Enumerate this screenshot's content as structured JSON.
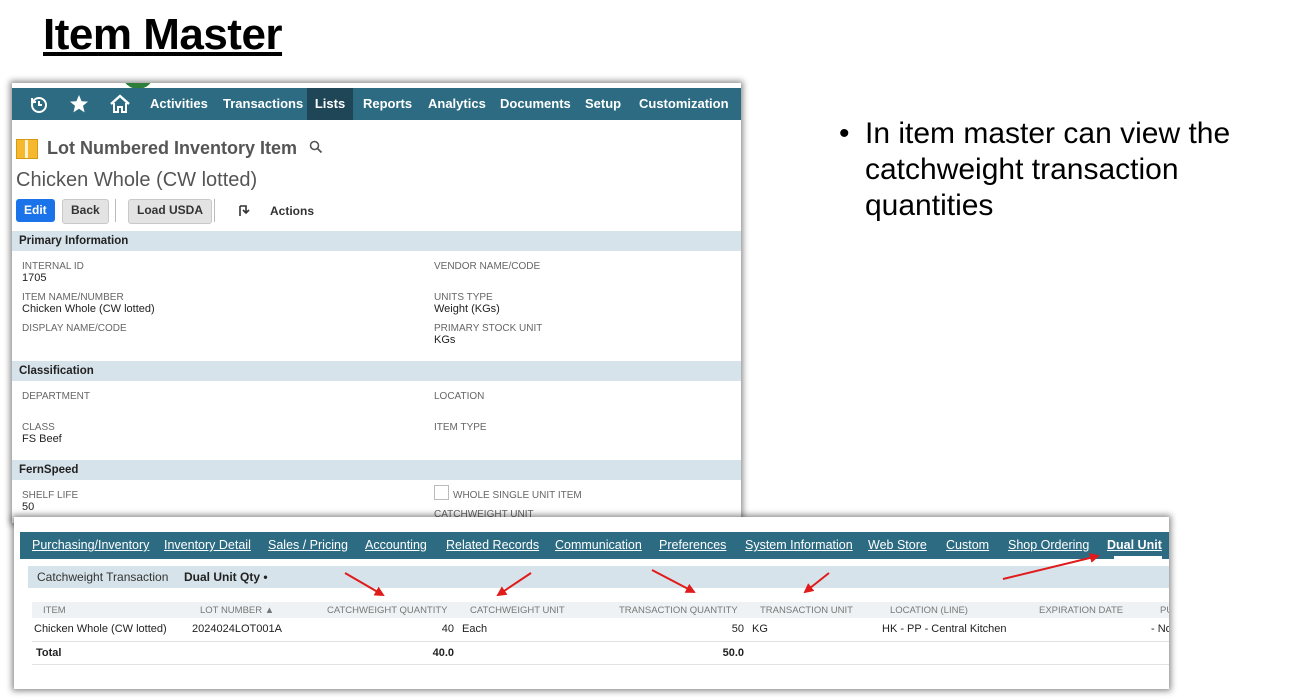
{
  "slide": {
    "title": "Item Master",
    "bullet": "In item master can view the catchweight transaction quantities"
  },
  "nav": {
    "icons": [
      "recent-icon",
      "star-icon",
      "home-icon"
    ],
    "items": [
      "Activities",
      "Transactions",
      "Lists",
      "Reports",
      "Analytics",
      "Documents",
      "Setup",
      "Customization"
    ],
    "active": "Lists"
  },
  "record": {
    "type": "Lot Numbered Inventory Item",
    "name": "Chicken Whole (CW lotted)",
    "buttons": {
      "edit": "Edit",
      "back": "Back",
      "load_usda": "Load USDA",
      "actions": "Actions"
    }
  },
  "primary_info": {
    "header": "Primary Information",
    "internal_id_label": "INTERNAL ID",
    "internal_id": "1705",
    "item_name_label": "ITEM NAME/NUMBER",
    "item_name": "Chicken Whole (CW lotted)",
    "display_name_label": "DISPLAY NAME/CODE",
    "vendor_name_label": "VENDOR NAME/CODE",
    "units_type_label": "UNITS TYPE",
    "units_type": "Weight (KGs)",
    "primary_stock_unit_label": "PRIMARY STOCK UNIT",
    "primary_stock_unit": "KGs"
  },
  "classification": {
    "header": "Classification",
    "department_label": "DEPARTMENT",
    "location_label": "LOCATION",
    "class_label": "CLASS",
    "class_value": "FS Beef",
    "item_type_label": "ITEM TYPE"
  },
  "fernspeed": {
    "header": "FernSpeed",
    "shelf_life_label": "SHELF LIFE",
    "shelf_life": "50",
    "whole_single_unit_label": "WHOLE SINGLE UNIT ITEM",
    "catchweight_unit_label": "CATCHWEIGHT UNIT"
  },
  "subtabs": {
    "tabs": [
      "Purchasing/Inventory",
      "Inventory Detail",
      "Sales / Pricing",
      "Accounting",
      "Related Records",
      "Communication",
      "Preferences",
      "System Information",
      "Web Store",
      "Custom",
      "Shop Ordering",
      "Dual Unit"
    ],
    "active": "Dual Unit",
    "inner_tabs": [
      "Catchweight Transaction",
      "Dual Unit Qty •"
    ],
    "inner_active": "Dual Unit Qty •"
  },
  "table": {
    "headers": [
      "ITEM",
      "LOT NUMBER ▲",
      "CATCHWEIGHT QUANTITY",
      "CATCHWEIGHT UNIT",
      "TRANSACTION QUANTITY",
      "TRANSACTION UNIT",
      "LOCATION (LINE)",
      "EXPIRATION DATE",
      "PU"
    ],
    "row": [
      "Chicken Whole (CW lotted)",
      "2024024LOT001A",
      "40",
      "Each",
      "50",
      "KG",
      "HK - PP - Central Kitchen",
      "",
      "- No"
    ],
    "total_label": "Total",
    "total_catchweight": "40.0",
    "total_transaction": "50.0"
  },
  "colors": {
    "nav": "#2c6b82",
    "nav_active": "#1e4656",
    "section": "#d7e3ea",
    "edit_button": "#1a73e8",
    "arrow": "#e01b1b"
  }
}
